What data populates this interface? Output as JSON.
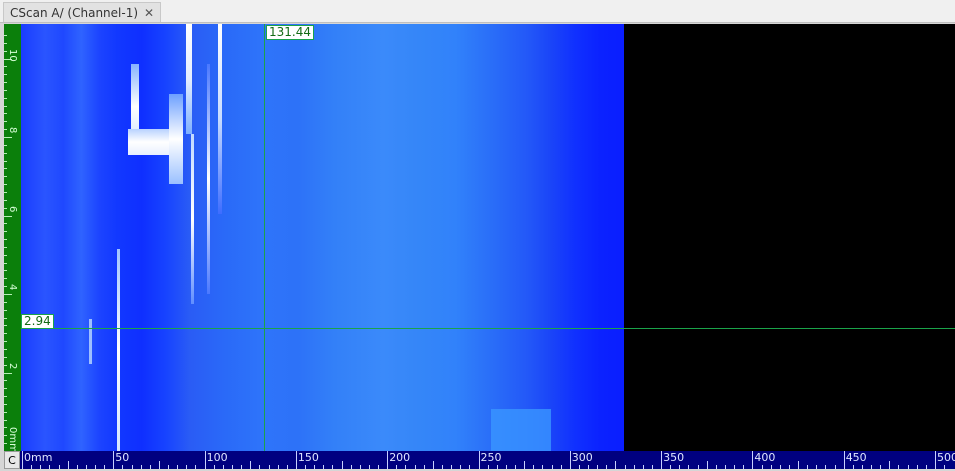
{
  "tab": {
    "title": "CScan A/ (Channel-1)",
    "close_glyph": "✕",
    "close_icon": "close-icon"
  },
  "cursor": {
    "x_value": "131.44",
    "y_value": "2.94"
  },
  "corner_label": "C",
  "x_axis": {
    "labels": [
      "0mm",
      "50",
      "100",
      "150",
      "200",
      "250",
      "300",
      "350",
      "400",
      "450",
      "500"
    ],
    "values": [
      0,
      50,
      100,
      150,
      200,
      250,
      300,
      350,
      400,
      450,
      500
    ],
    "range": [
      0,
      500
    ]
  },
  "y_axis": {
    "labels": [
      "0mm",
      "2",
      "4",
      "6",
      "8",
      "10"
    ],
    "values": [
      0,
      2,
      4,
      6,
      8,
      10
    ],
    "range": [
      0,
      10.6
    ]
  },
  "colors": {
    "scan_blue": "#1a44ff",
    "no_data": "#000000",
    "cursor_line": "#1aa34a",
    "y_axis_bg": "#0b7f0b",
    "x_axis_bg": "#000080"
  }
}
